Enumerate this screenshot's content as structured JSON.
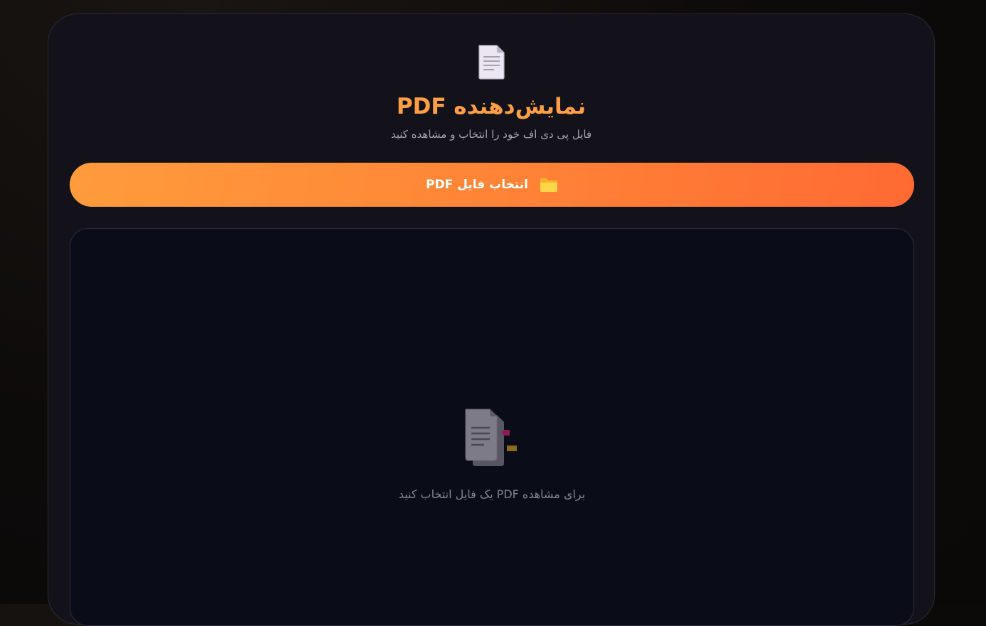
{
  "header": {
    "icon": "page-facing-up-icon",
    "title": "نمایش‌دهنده PDF",
    "subtitle": "فایل پی دی اف خود را انتخاب و مشاهده کنید"
  },
  "select_button": {
    "icon": "folder-icon",
    "label": "انتخاب فایل PDF"
  },
  "viewer": {
    "placeholder_icon": "bookmark-tabs-icon",
    "placeholder_text": "برای مشاهده PDF یک فایل انتخاب کنید"
  },
  "colors": {
    "accent": "#ff9f45",
    "button_start": "#ff9c3c",
    "button_end": "#ff6a33",
    "card_bg": "#13121b",
    "viewer_bg": "#0a0d17"
  }
}
